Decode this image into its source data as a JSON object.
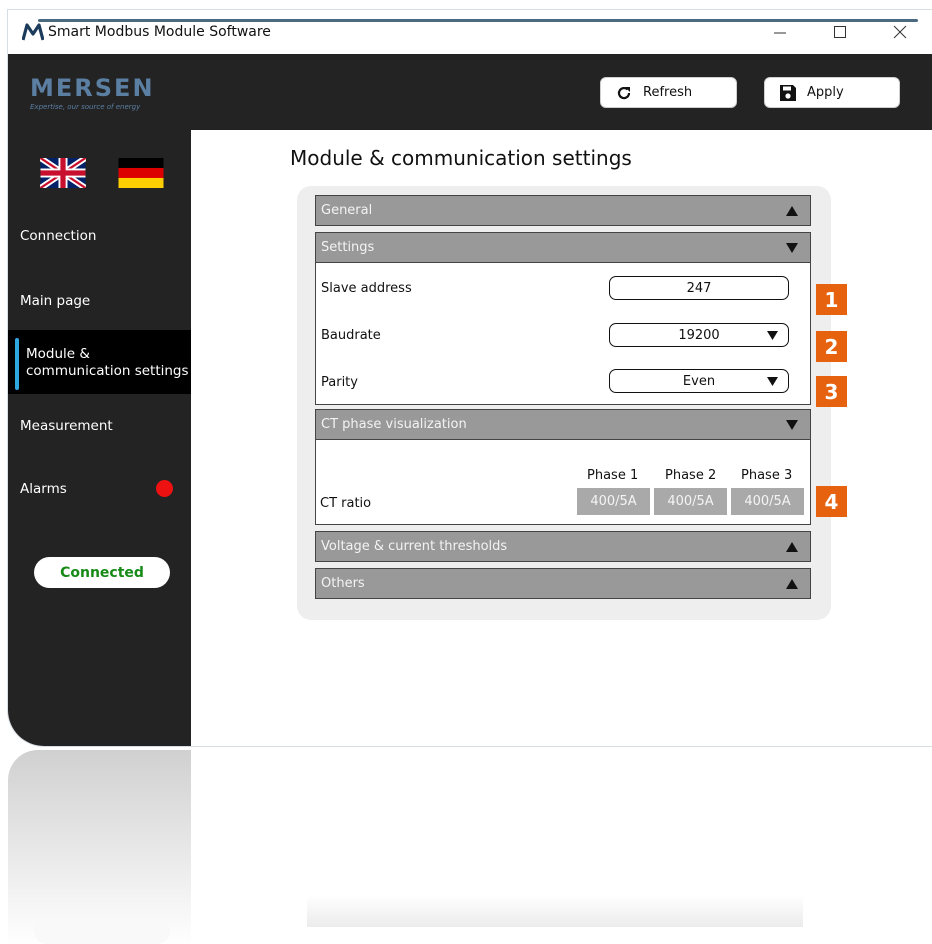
{
  "window": {
    "title": "Smart Modbus Module Software",
    "controls": [
      "minimize",
      "maximize",
      "close"
    ]
  },
  "header": {
    "brand_name": "MERSEN",
    "brand_tagline": "Expertise, our source of energy",
    "refresh_label": "Refresh",
    "apply_label": "Apply",
    "refresh_icon": "refresh-icon",
    "apply_icon": "save-icon"
  },
  "sidebar": {
    "languages": [
      "English (UK flag)",
      "German (DE flag)"
    ],
    "items": [
      {
        "label": "Connection",
        "active": false
      },
      {
        "label": "Main page",
        "active": false
      },
      {
        "label": "Module & communication settings",
        "active": true
      },
      {
        "label": "Measurement",
        "active": false
      },
      {
        "label": "Alarms",
        "active": false,
        "alert": true
      }
    ],
    "status": "Connected"
  },
  "main": {
    "title": "Module & communication settings",
    "sections": [
      {
        "label": "General",
        "expanded": false
      },
      {
        "label": "Settings",
        "expanded": true
      },
      {
        "label": "CT phase visualization",
        "expanded": true
      },
      {
        "label": "Voltage & current thresholds",
        "expanded": false
      },
      {
        "label": "Others",
        "expanded": false
      }
    ],
    "settings": {
      "slave_address_label": "Slave address",
      "slave_address_value": "247",
      "baudrate_label": "Baudrate",
      "baudrate_value": "19200",
      "parity_label": "Parity",
      "parity_value": "Even"
    },
    "ct": {
      "phase_headers": [
        "Phase 1",
        "Phase 2",
        "Phase 3"
      ],
      "ratio_label": "CT ratio",
      "ratio_values": [
        "400/5A",
        "400/5A",
        "400/5A"
      ]
    },
    "callouts": [
      "1",
      "2",
      "3",
      "4"
    ]
  },
  "colors": {
    "sidebar_bg": "#232323",
    "active_indicator": "#2ea7e0",
    "brand_blue": "#5b7fa3",
    "section_header": "#999999",
    "callout_orange": "#e6620f",
    "status_green": "#178a17",
    "alarm_red": "#ee1111"
  }
}
